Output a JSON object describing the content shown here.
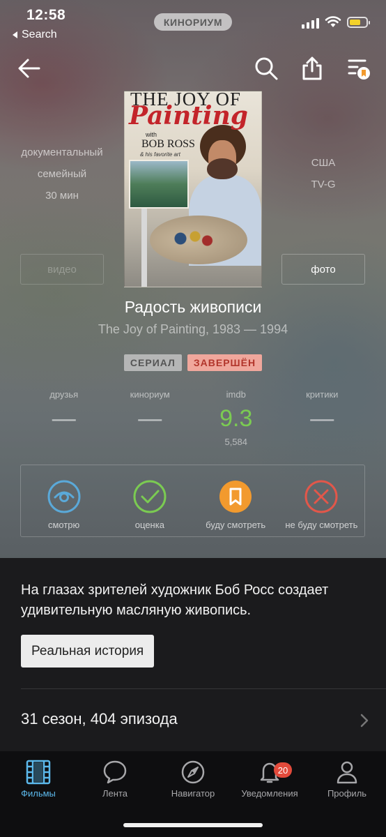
{
  "status_bar": {
    "time": "12:58",
    "back_label": "Search",
    "app_pill": "КИНОРИУМ",
    "battery_color": "#f3d12a"
  },
  "nav": {
    "back_icon": "arrow-left-icon",
    "search_icon": "search-icon",
    "share_icon": "share-icon",
    "list_icon": "watchlist-icon"
  },
  "poster": {
    "title_line1": "THE JOY OF",
    "title_line2": "Painting",
    "with": "with",
    "author": "BOB ROSS",
    "tagline": "& his favorite art"
  },
  "meta": {
    "genres": [
      "документальный",
      "семейный"
    ],
    "duration": "30 мин",
    "country": "США",
    "rating": "TV-G",
    "video_button": "видео",
    "photo_button": "фото"
  },
  "title": "Радость живописи",
  "subtitle": "The Joy of Painting, 1983 — 1994",
  "badges": {
    "type": "СЕРИАЛ",
    "status": "ЗАВЕРШЁН"
  },
  "ratings": [
    {
      "label": "друзья",
      "value": "—"
    },
    {
      "label": "кинориум",
      "value": "—"
    },
    {
      "label": "imdb",
      "value": "9.3",
      "count": "5,584"
    },
    {
      "label": "критики",
      "value": "—"
    }
  ],
  "actions": [
    {
      "label": "смотрю",
      "icon": "eye-icon",
      "color": "#5aa9d9"
    },
    {
      "label": "оценка",
      "icon": "check-icon",
      "color": "#7bcb52"
    },
    {
      "label": "буду смотреть",
      "icon": "bookmark-icon",
      "color": "#f29a2e"
    },
    {
      "label": "не буду смотреть",
      "icon": "cross-icon",
      "color": "#e2574a"
    }
  ],
  "description": "На глазах зрителей художник Боб Росс создает удивительную масляную живопись.",
  "tag_chip": "Реальная история",
  "seasons": "31 сезон, 404 эпизода",
  "tabs": [
    {
      "label": "Фильмы",
      "icon": "film-icon"
    },
    {
      "label": "Лента",
      "icon": "chat-bubble-icon"
    },
    {
      "label": "Навигатор",
      "icon": "compass-icon"
    },
    {
      "label": "Уведомления",
      "icon": "bell-icon",
      "badge": "20"
    },
    {
      "label": "Профиль",
      "icon": "person-icon"
    }
  ],
  "colors": {
    "accent_blue": "#5cb9ec",
    "imdb_green": "#7bcb52",
    "badge_red": "#e24a3b"
  }
}
